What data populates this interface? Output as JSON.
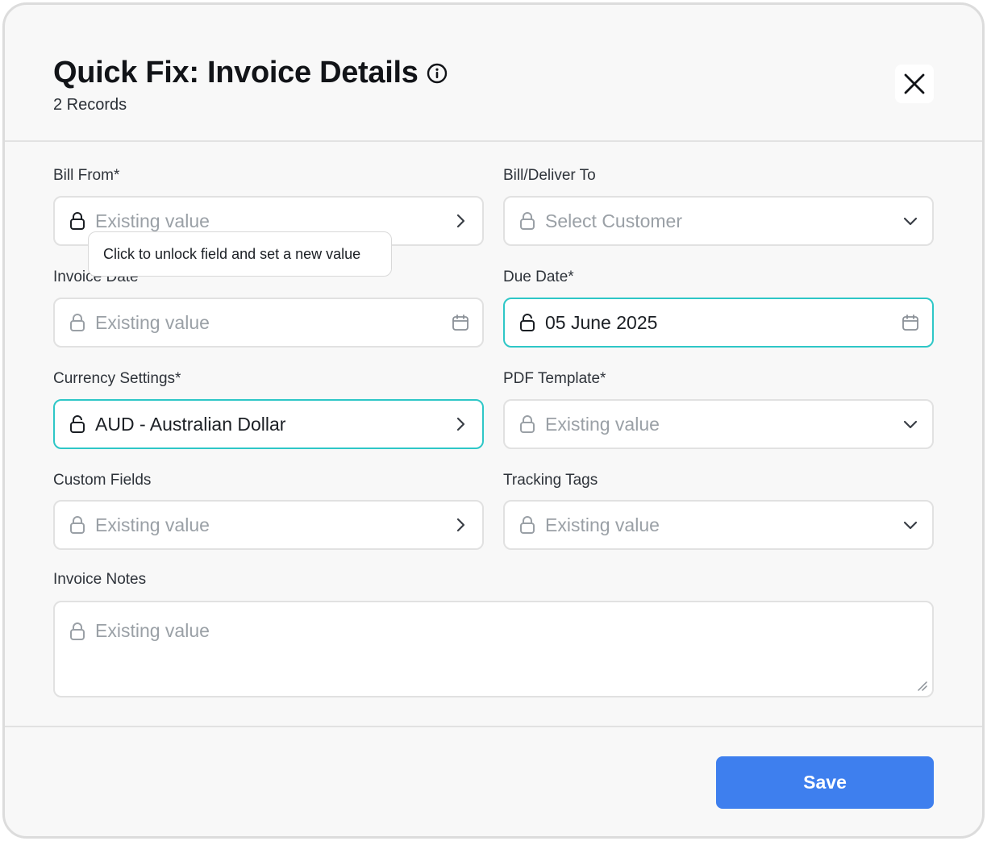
{
  "header": {
    "title": "Quick Fix: Invoice Details",
    "subtitle": "2 Records",
    "info_icon": "info-circle-icon",
    "close_icon": "close-icon"
  },
  "fields": {
    "bill_from": {
      "label": "Bill From*",
      "value": "Existing value",
      "icon": "chevron-right-icon"
    },
    "bill_deliver_to": {
      "label": "Bill/Deliver To",
      "value": "Select Customer",
      "icon": "chevron-down-icon"
    },
    "invoice_date": {
      "label": "Invoice Date",
      "value": "Existing value",
      "icon": "calendar-icon"
    },
    "due_date": {
      "label": "Due Date*",
      "value": "05 June 2025",
      "icon": "calendar-icon"
    },
    "currency_settings": {
      "label": "Currency Settings*",
      "value": "AUD - Australian Dollar",
      "icon": "chevron-right-icon"
    },
    "pdf_template": {
      "label": "PDF Template*",
      "value": "Existing value",
      "icon": "chevron-down-icon"
    },
    "custom_fields": {
      "label": "Custom Fields",
      "value": "Existing value",
      "icon": "chevron-right-icon"
    },
    "tracking_tags": {
      "label": "Tracking Tags",
      "value": "Existing value",
      "icon": "chevron-down-icon"
    },
    "invoice_notes": {
      "label": "Invoice Notes",
      "value": "Existing value"
    }
  },
  "tooltip": {
    "text": "Click to unlock field and set a new value"
  },
  "footer": {
    "save_label": "Save"
  },
  "colors": {
    "accent": "#3e7fee",
    "active_border": "#2ec7c7",
    "placeholder": "#9aa0a6"
  }
}
